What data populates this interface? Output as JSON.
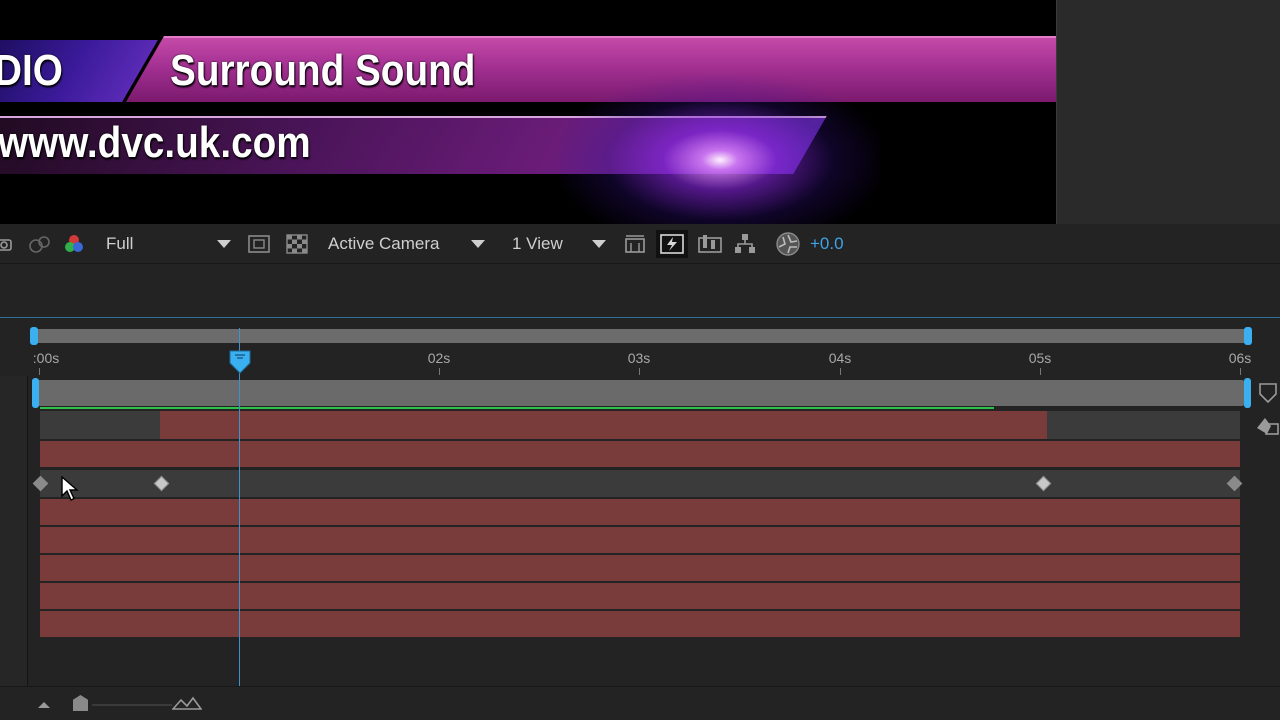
{
  "preview": {
    "title_left": "DIO",
    "title_main": "Surround Sound",
    "url": "www.dvc.uk.com"
  },
  "viewer_toolbar": {
    "resolution": "Full",
    "camera_view": "Active Camera",
    "view_layout": "1 View",
    "exposure": "+0.0"
  },
  "timeline": {
    "ruler_ticks": [
      ":00s",
      "02s",
      "03s",
      "04s",
      "05s",
      "06s"
    ],
    "current_time_marker": "playhead"
  },
  "colors": {
    "accent": "#3ab0f0",
    "layer_bar": "#7a3b3b",
    "render_bar": "#2ec24a",
    "title_bar": "#a33092"
  }
}
